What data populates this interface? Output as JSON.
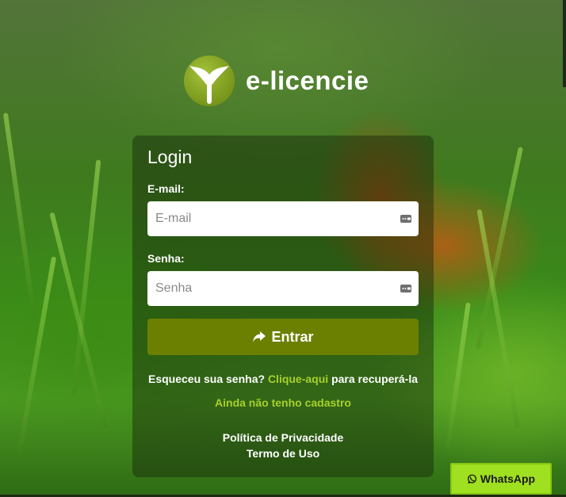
{
  "brand": {
    "name": "e-licencie"
  },
  "login": {
    "title": "Login",
    "email_label": "E-mail:",
    "email_placeholder": "E-mail",
    "email_value": "",
    "password_label": "Senha:",
    "password_placeholder": "Senha",
    "password_value": "",
    "submit_label": "Entrar",
    "forgot_prefix": "Esqueceu sua senha?",
    "forgot_link": "Clique-aqui",
    "forgot_suffix": "para recuperá-la",
    "signup_link": "Ainda não tenho cadastro",
    "privacy_link": "Política de Privacidade",
    "terms_link": "Termo de Uso"
  },
  "whatsapp": {
    "label": "WhatsApp"
  },
  "colors": {
    "accent": "#6b8000",
    "link": "#a6d12a",
    "whatsapp_bg": "#9fe020"
  },
  "icons": {
    "logo": "sprout-logo-icon",
    "field": "password-manager-icon",
    "submit": "share-arrow-icon",
    "whatsapp": "whatsapp-icon"
  }
}
